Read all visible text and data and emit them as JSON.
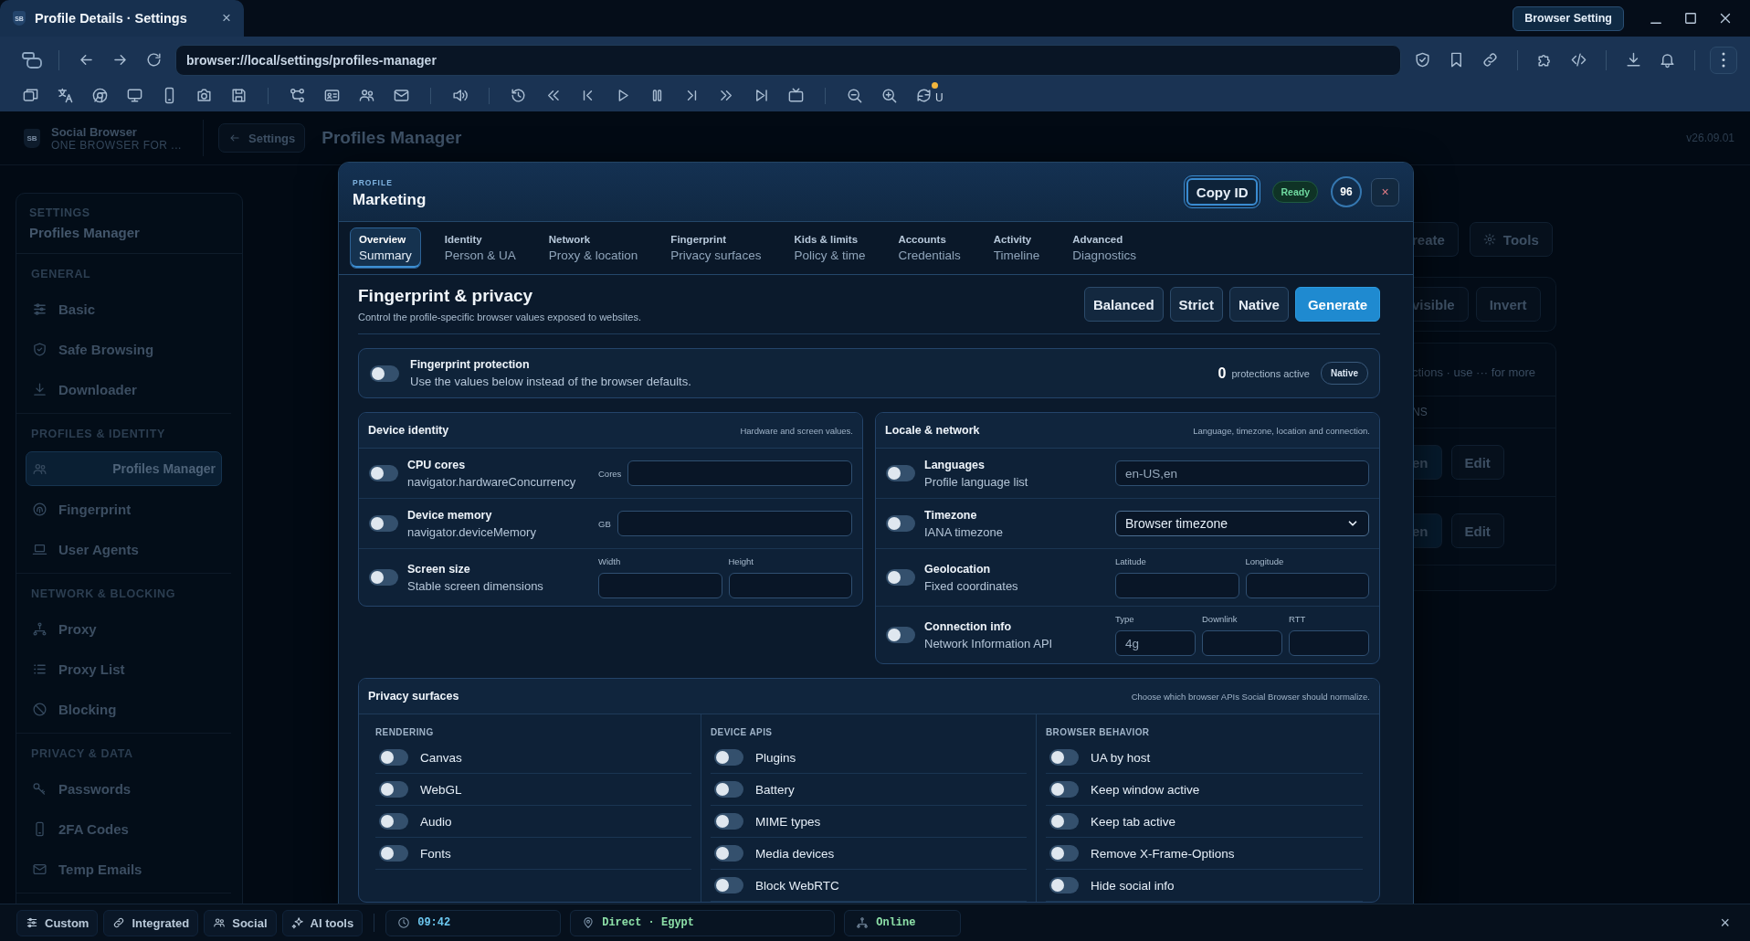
{
  "browser": {
    "tab": {
      "logo": "SB",
      "title": "Profile Details · Settings",
      "close": "×"
    },
    "corner_button": "Browser Setting",
    "address": "browser://local/settings/profiles-manager",
    "toolbar_badge": "U"
  },
  "page": {
    "brand": {
      "logo": "SB",
      "name": "Social Browser",
      "tagline": "ONE BROWSER FOR ..."
    },
    "back_button": "Settings",
    "title": "Profiles Manager",
    "version": "v26.09.01",
    "sidebar": {
      "label": "SETTINGS",
      "title": "Profiles Manager",
      "groups": [
        {
          "title": "GENERAL",
          "items": [
            {
              "label": "Basic",
              "selected": false
            },
            {
              "label": "Safe Browsing",
              "selected": false
            },
            {
              "label": "Downloader",
              "selected": false
            }
          ]
        },
        {
          "title": "PROFILES & IDENTITY",
          "items": [
            {
              "label": "Profiles Manager",
              "selected": true
            },
            {
              "label": "Fingerprint",
              "selected": false
            },
            {
              "label": "User Agents",
              "selected": false
            }
          ]
        },
        {
          "title": "NETWORK & BLOCKING",
          "items": [
            {
              "label": "Proxy",
              "selected": false
            },
            {
              "label": "Proxy List",
              "selected": false
            },
            {
              "label": "Blocking",
              "selected": false
            }
          ]
        },
        {
          "title": "PRIVACY & DATA",
          "items": [
            {
              "label": "Passwords",
              "selected": false
            },
            {
              "label": "2FA Codes",
              "selected": false
            },
            {
              "label": "Temp Emails",
              "selected": false
            }
          ]
        }
      ]
    },
    "main": {
      "actions": [
        "reate",
        "Tools"
      ],
      "filters": [
        "visible",
        "Invert"
      ],
      "hint": "ctions · use ··· for more",
      "column_heading": "NS",
      "rows": [
        {
          "open": "en",
          "edit": "Edit"
        },
        {
          "open": "en",
          "edit": "Edit"
        }
      ]
    }
  },
  "modal": {
    "label": "PROFILE",
    "name": "Marketing",
    "copy_button": "Copy ID",
    "status": "Ready",
    "score": "96",
    "close": "×",
    "tabs": [
      {
        "title": "Overview",
        "subtitle": "Summary",
        "selected": true
      },
      {
        "title": "Identity",
        "subtitle": "Person & UA",
        "selected": false
      },
      {
        "title": "Network",
        "subtitle": "Proxy & location",
        "selected": false
      },
      {
        "title": "Fingerprint",
        "subtitle": "Privacy surfaces",
        "selected": false
      },
      {
        "title": "Kids & limits",
        "subtitle": "Policy & time",
        "selected": false
      },
      {
        "title": "Accounts",
        "subtitle": "Credentials",
        "selected": false
      },
      {
        "title": "Activity",
        "subtitle": "Timeline",
        "selected": false
      },
      {
        "title": "Advanced",
        "subtitle": "Diagnostics",
        "selected": false
      }
    ],
    "section": {
      "title": "Fingerprint & privacy",
      "subtitle": "Control the profile-specific browser values exposed to websites.",
      "presets": [
        {
          "label": "Balanced",
          "kind": "secondary"
        },
        {
          "label": "Strict",
          "kind": "secondary"
        },
        {
          "label": "Native",
          "kind": "secondary"
        },
        {
          "label": "Generate",
          "kind": "primary"
        }
      ]
    },
    "protection": {
      "title": "Fingerprint protection",
      "description": "Use the values below instead of the browser defaults.",
      "on": false,
      "count": "0",
      "count_label": "protections active",
      "mode": "Native"
    },
    "cards": [
      {
        "title": "Device identity",
        "hint": "Hardware and screen values.",
        "rows": [
          {
            "name": "CPU cores",
            "detail": "navigator.hardwareConcurrency",
            "on": false,
            "fields": [
              {
                "kind": "inline",
                "label": "Cores"
              }
            ]
          },
          {
            "name": "Device memory",
            "detail": "navigator.deviceMemory",
            "on": false,
            "fields": [
              {
                "kind": "inline",
                "label": "GB"
              }
            ]
          },
          {
            "name": "Screen size",
            "detail": "Stable screen dimensions",
            "on": false,
            "fields": [
              {
                "kind": "stacked",
                "label": "Width"
              },
              {
                "kind": "stacked",
                "label": "Height"
              }
            ]
          }
        ]
      },
      {
        "title": "Locale & network",
        "hint": "Language, timezone, location and connection.",
        "rows": [
          {
            "name": "Languages",
            "detail": "Profile language list",
            "on": false,
            "fields": [
              {
                "kind": "plain",
                "placeholder": "en-US,en"
              }
            ]
          },
          {
            "name": "Timezone",
            "detail": "IANA timezone",
            "on": false,
            "fields": [
              {
                "kind": "select",
                "value": "Browser timezone"
              }
            ]
          },
          {
            "name": "Geolocation",
            "detail": "Fixed coordinates",
            "on": false,
            "fields": [
              {
                "kind": "stacked",
                "label": "Latitude"
              },
              {
                "kind": "stacked",
                "label": "Longitude"
              }
            ]
          },
          {
            "name": "Connection info",
            "detail": "Network Information API",
            "on": false,
            "fields": [
              {
                "kind": "stacked",
                "label": "Type",
                "placeholder": "4g"
              },
              {
                "kind": "stacked",
                "label": "Downlink"
              },
              {
                "kind": "stacked",
                "label": "RTT"
              }
            ]
          }
        ]
      }
    ],
    "privacy": {
      "title": "Privacy surfaces",
      "hint": "Choose which browser APIs Social Browser should normalize.",
      "columns": [
        {
          "title": "RENDERING",
          "items": [
            {
              "label": "Canvas",
              "on": false
            },
            {
              "label": "WebGL",
              "on": false
            },
            {
              "label": "Audio",
              "on": false
            },
            {
              "label": "Fonts",
              "on": false
            }
          ]
        },
        {
          "title": "DEVICE APIS",
          "items": [
            {
              "label": "Plugins",
              "on": false
            },
            {
              "label": "Battery",
              "on": false
            },
            {
              "label": "MIME types",
              "on": false
            },
            {
              "label": "Media devices",
              "on": false
            },
            {
              "label": "Block WebRTC",
              "on": false
            }
          ]
        },
        {
          "title": "BROWSER BEHAVIOR",
          "items": [
            {
              "label": "UA by host",
              "on": false
            },
            {
              "label": "Keep window active",
              "on": false
            },
            {
              "label": "Keep tab active",
              "on": false
            },
            {
              "label": "Remove X-Frame-Options",
              "on": false
            },
            {
              "label": "Hide social info",
              "on": false
            }
          ]
        }
      ]
    }
  },
  "status_bar": {
    "modes": [
      "Custom",
      "Integrated",
      "Social",
      "AI tools"
    ],
    "time": "09:42",
    "route": "Direct · Egypt",
    "connection": "Online",
    "close": "×"
  }
}
